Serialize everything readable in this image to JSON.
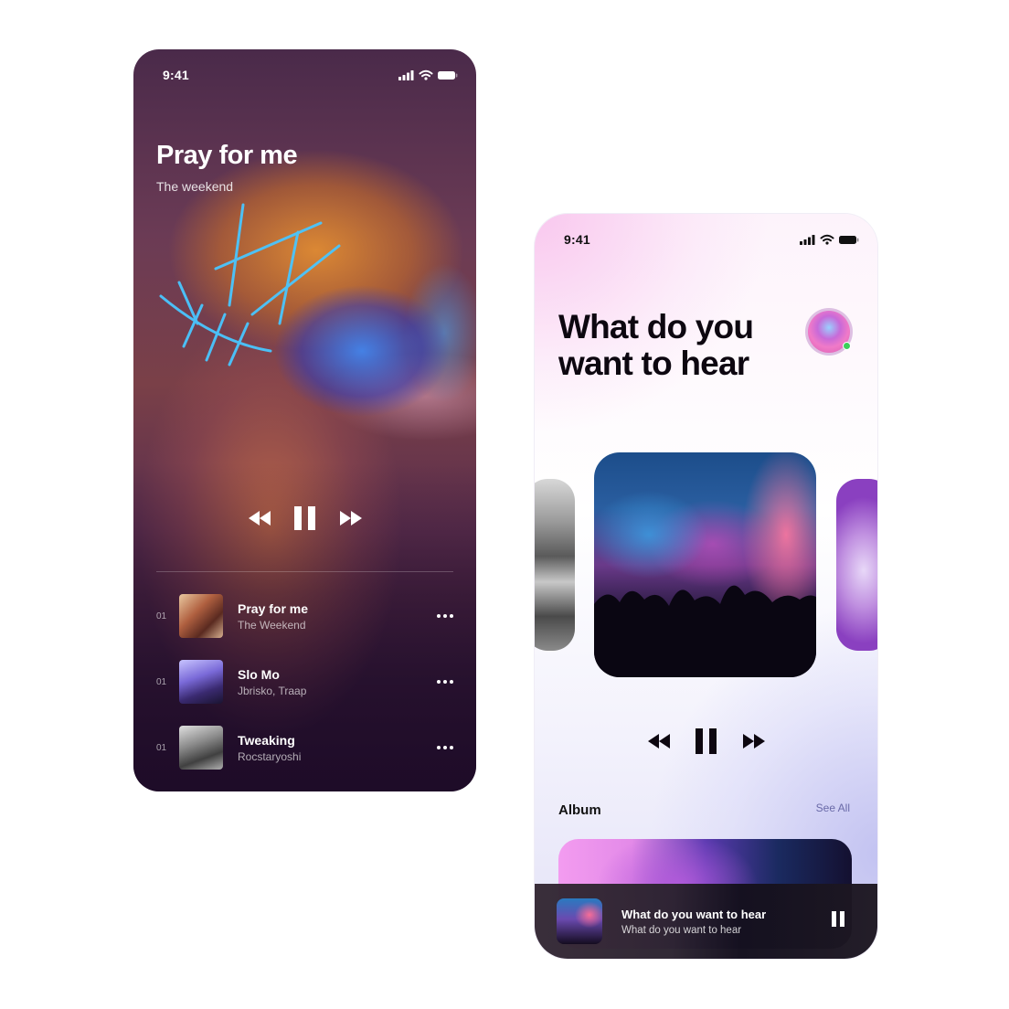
{
  "player_screen": {
    "status_time": "9:41",
    "title": "Pray for me",
    "artist": "The weekend",
    "controls": {
      "rewind_icon": "rewind-icon",
      "pause_icon": "pause-icon",
      "forward_icon": "fast-forward-icon"
    },
    "tracks": [
      {
        "number": "01",
        "name": "Pray for me",
        "artist": "The Weekend",
        "menu_icon": "more-horizontal-icon"
      },
      {
        "number": "01",
        "name": "Slo Mo",
        "artist": "Jbrisko, Traap",
        "menu_icon": "more-horizontal-icon"
      },
      {
        "number": "01",
        "name": "Tweaking",
        "artist": "Rocstaryoshi",
        "menu_icon": "more-horizontal-icon"
      }
    ]
  },
  "home_screen": {
    "status_time": "9:41",
    "heading_line1": "What do you",
    "heading_line2": "want to hear",
    "carousel": {
      "items": [
        "previous-cover",
        "concert-cover",
        "next-cover"
      ]
    },
    "controls": {
      "rewind_icon": "rewind-icon",
      "pause_icon": "pause-icon",
      "forward_icon": "fast-forward-icon"
    },
    "album_section": {
      "label": "Album",
      "see_all": "See All"
    },
    "mini_player": {
      "title": "What do you want to hear",
      "subtitle": "What do you want to hear",
      "pause_icon": "pause-icon"
    }
  },
  "colors": {
    "home_heading": "#0d0710",
    "see_all_link": "#6a6aa8",
    "online_dot": "#3ccf5a"
  }
}
